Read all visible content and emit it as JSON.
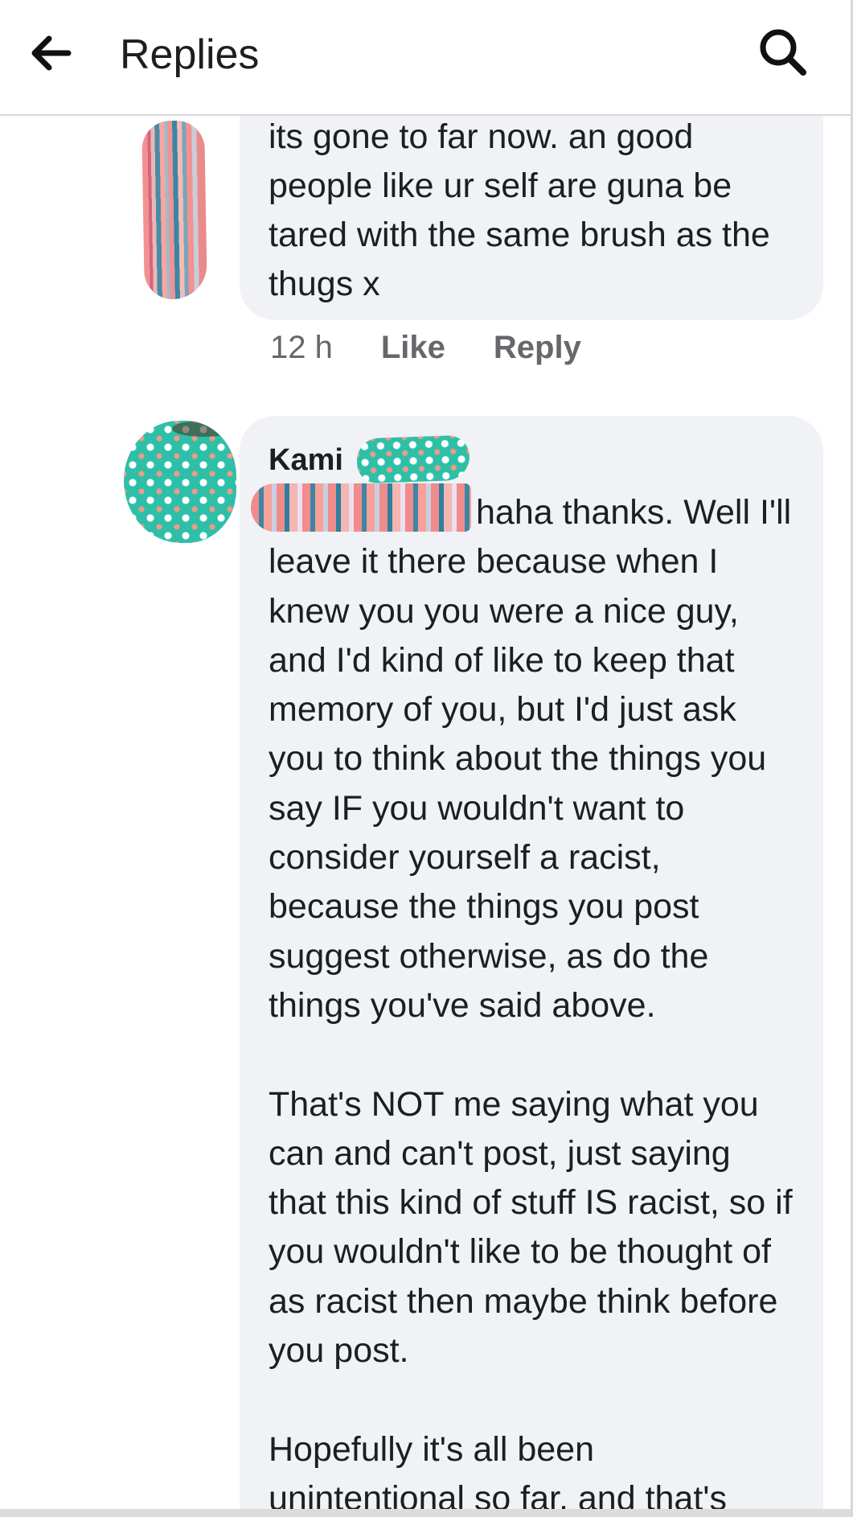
{
  "header": {
    "title": "Replies",
    "back_icon": "arrow-left-icon",
    "search_icon": "search-icon"
  },
  "comments": [
    {
      "text": "its gone to far now. an good people like ur self are guna be tared with the same brush as the thugs x",
      "time": "12 h",
      "like_label": "Like",
      "reply_label": "Reply"
    },
    {
      "author": "Kami",
      "text_lines": [
        "haha thanks. Well I'll leave it there because when I knew you you were a nice guy, and I'd kind of like to keep that memory of you, but I'd just ask you to think about the things you say IF you wouldn't want to consider yourself a racist, because the things you post suggest otherwise, as do the things you've said above.",
        "That's NOT me saying what you can and can't post, just saying that this kind of stuff IS racist, so if you wouldn't like to be thought of as racist then maybe think before you post.",
        "Hopefully it's all been unintentional so far, and that's"
      ]
    }
  ],
  "colors": {
    "bubble": "#f0f2f5",
    "text": "#1c1e21",
    "meta": "#65676b"
  }
}
